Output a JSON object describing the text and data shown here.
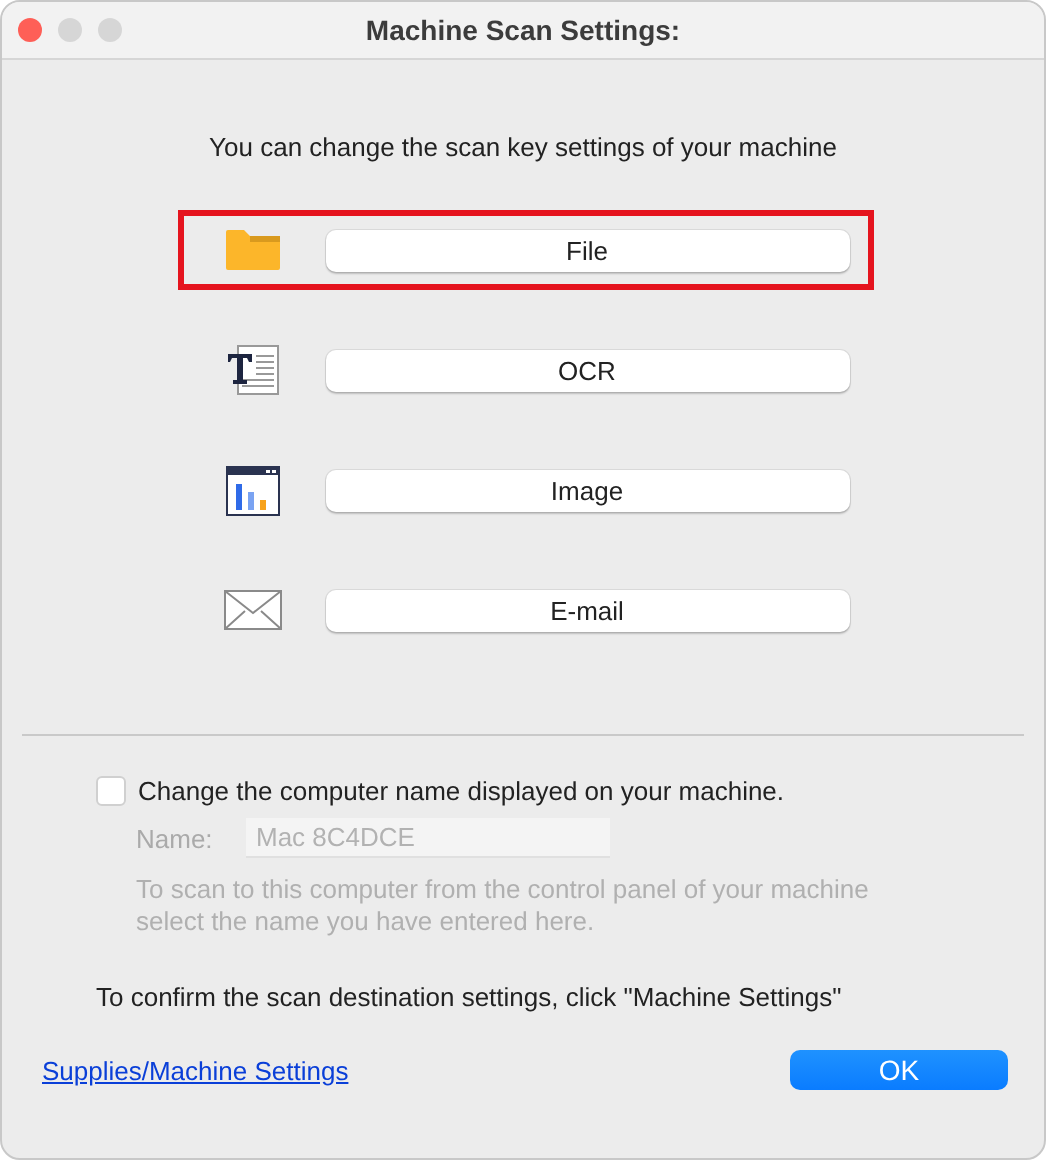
{
  "window": {
    "title": "Machine Scan Settings:"
  },
  "intro": "You can change the scan key settings of your machine",
  "scan_keys": [
    {
      "kind": "folder",
      "label": "File",
      "highlighted": true
    },
    {
      "kind": "text",
      "label": "OCR",
      "highlighted": false
    },
    {
      "kind": "image",
      "label": "Image",
      "highlighted": false
    },
    {
      "kind": "mail",
      "label": "E-mail",
      "highlighted": false
    }
  ],
  "computer_name": {
    "label": "Change the computer name displayed on your machine.",
    "checked": false,
    "name_label": "Name:",
    "placeholder": "Mac 8C4DCE",
    "help": "To scan to this computer from the control panel of your machine select the name you have entered here."
  },
  "confirm_text": "To confirm the scan destination settings, click \"Machine Settings\"",
  "link": "Supplies/Machine Settings",
  "buttons": [
    "OK"
  ]
}
